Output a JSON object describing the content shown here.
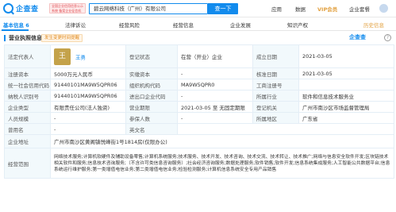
{
  "header": {
    "logo": "企查查",
    "logo_sub": "Qcc.com 企业信用信息查询",
    "badge": "全国企业信用信息公示系统 备案企业征信机构",
    "search_value": "碧云网络科技（广州）有限公司",
    "search_button": "查一下",
    "nav": [
      "应用",
      "数据",
      "VIP会员",
      "企业套餐"
    ]
  },
  "tabs": [
    {
      "label": "基本信息 6",
      "active": true
    },
    {
      "label": "法律诉讼"
    },
    {
      "label": "经营风险"
    },
    {
      "label": "经营信息"
    },
    {
      "label": "企业发展"
    },
    {
      "label": "知识产权"
    },
    {
      "label": "历史信息"
    }
  ],
  "section": {
    "title": "营业执照信息",
    "tag": "发生变更时间提醒",
    "logo": "企查查",
    "help": "?"
  },
  "rows": {
    "legal_rep_label": "法定代表人",
    "legal_rep_avatar": "王",
    "legal_rep_name": "王勇",
    "status_label": "登记状态",
    "status_value": "在营（开业）企业",
    "founded_label": "成立日期",
    "founded_value": "2021-03-05",
    "reg_capital_label": "注册资本",
    "reg_capital_value": "5000万元人民币",
    "paid_capital_label": "实缴资本",
    "paid_capital_value": "-",
    "approval_label": "核准日期",
    "approval_value": "2021-03-05",
    "usci_label": "统一社会信用代码",
    "usci_value": "91440101MA9W5QPR06",
    "org_code_label": "组织机构代码",
    "org_code_value": "MA9W5QPR0",
    "bizreg_label": "工商注册号",
    "bizreg_value": "",
    "taxid_label": "纳税人识别号",
    "taxid_value": "91440101MA9W5QPR06",
    "imp_exp_label": "进出口企业代码",
    "imp_exp_value": "-",
    "industry_label": "所属行业",
    "industry_value": "软件和信息技术服务业",
    "type_label": "企业类型",
    "type_value": "有限责任公司(法人独资)",
    "term_label": "营业期限",
    "term_value": "2021-03-05 至 无固定期限",
    "authority_label": "登记机关",
    "authority_value": "广州市南沙区市场监督管理局",
    "staff_label": "人员规模",
    "staff_value": "-",
    "insured_label": "参保人数",
    "insured_value": "-",
    "region_label": "所属地区",
    "region_value": "广东省",
    "former_label": "曾用名",
    "former_value": "-",
    "english_label": "英文名",
    "english_value": "",
    "address_label": "企业地址",
    "address_value": "广州市南沙区黄阁镇悦峰街1号1814房(仅限办公)",
    "scope_label": "经营范围",
    "scope_value": "网络技术服务;计算机软硬件及辅助设备零售;计算机系统服务;技术服务、技术开发、技术咨询、技术交流、技术转让、技术推广;网络与信息安全软件开发;区块链技术相关软件和服务;信息技术咨询服务;（不含许可类信息咨询服务）;社会经济咨询服务;数据处理服务;软件销售;软件开发;信息系统集成服务;人工智能公共数据平台;信息系统运行维护服务;第一类增值电信业务;第二类增值电信业务;检验检测服务;计算机信息系统安全专用产品销售"
  },
  "colors": {
    "accent": "#128bed",
    "label_bg": "#f2f9fc",
    "border": "#e4eef6",
    "warning": "#e08a1f"
  }
}
